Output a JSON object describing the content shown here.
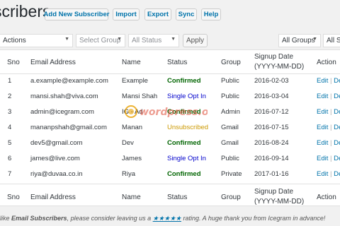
{
  "page": {
    "title": "scribers"
  },
  "toolbar": {
    "add_new": "Add New Subscriber",
    "import": "Import",
    "export": "Export",
    "sync": "Sync",
    "help": "Help"
  },
  "filters": {
    "bulk_actions": "Actions",
    "select_group": "Select Group",
    "all_status": "All Status",
    "apply": "Apply",
    "all_groups": "All Groups",
    "all_s": "All S"
  },
  "table": {
    "columns": [
      "Sno",
      "Email Address",
      "Name",
      "Status",
      "Group",
      "Signup Date",
      "(YYYY-MM-DD)",
      "Action"
    ],
    "rows": [
      {
        "sno": "1",
        "email": "a.example@example.com",
        "name": "Example",
        "status": "Confirmed",
        "group": "Public",
        "date": "2016-02-03",
        "edit": "Edit",
        "del": "Del"
      },
      {
        "sno": "2",
        "email": "mansi.shah@viva.com",
        "name": "Mansi Shah",
        "status": "Single Opt In",
        "group": "Public",
        "date": "2016-03-04",
        "edit": "Edit",
        "del": "Del"
      },
      {
        "sno": "3",
        "email": "admin@icegram.com",
        "name": "IG - Ad",
        "status": "Confirmed",
        "group": "Admin",
        "date": "2016-07-12",
        "edit": "Edit",
        "del": "Del"
      },
      {
        "sno": "4",
        "email": "mananpshah@gmail.com",
        "name": "Manan",
        "status": "Unsubscribed",
        "group": "Gmail",
        "date": "2016-07-15",
        "edit": "Edit",
        "del": "Del"
      },
      {
        "sno": "5",
        "email": "dev5@gmail.com",
        "name": "Dev",
        "status": "Confirmed",
        "group": "Gmail",
        "date": "2016-08-24",
        "edit": "Edit",
        "del": "Del"
      },
      {
        "sno": "6",
        "email": "james@live.com",
        "name": "James",
        "status": "Single Opt In",
        "group": "Public",
        "date": "2016-09-14",
        "edit": "Edit",
        "del": "Del"
      },
      {
        "sno": "7",
        "email": "riya@duvaa.co.in",
        "name": "Riya",
        "status": "Confirmed",
        "group": "Private",
        "date": "2017-01-16",
        "edit": "Edit",
        "del": "Del"
      }
    ]
  },
  "watermark": {
    "text": "wordpress.org"
  },
  "footer": {
    "prefix": "like ",
    "plugin": "Email Subscribers",
    "middle": ", please consider leaving us a ",
    "stars": "★★★★★",
    "suffix": " rating. A huge thank you from Icegram in advance!"
  },
  "colors": {
    "confirmed": "#006400",
    "single_opt_in": "#0000cc",
    "unsubscribed": "#cc9900",
    "link": "#0073aa"
  }
}
